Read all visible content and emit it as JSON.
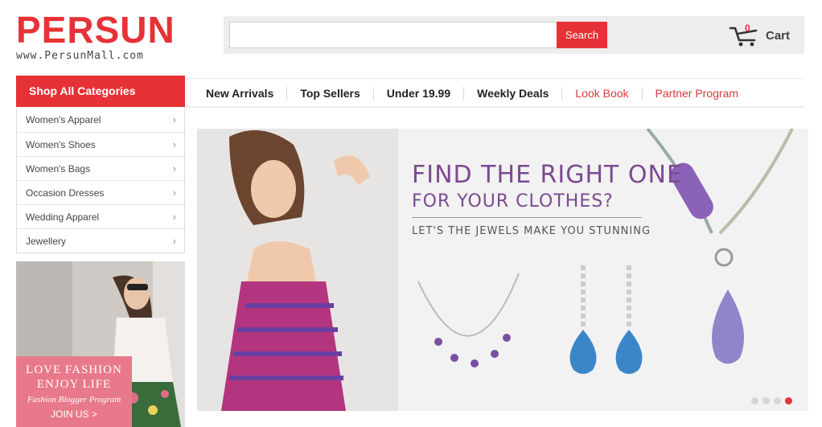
{
  "header": {
    "logo_text": "PERSUN",
    "logo_url": "www.PersunMall.com",
    "search": {
      "placeholder": "",
      "button_label": "Search"
    },
    "cart": {
      "count": "0",
      "label": "Cart"
    }
  },
  "nav": {
    "shop_all": "Shop All Categories",
    "links": [
      {
        "label": "New Arrivals",
        "style": "bold"
      },
      {
        "label": "Top Sellers",
        "style": "bold"
      },
      {
        "label": "Under 19.99",
        "style": "bold"
      },
      {
        "label": "Weekly Deals",
        "style": "bold"
      },
      {
        "label": "Look Book",
        "style": "red"
      },
      {
        "label": "Partner Program",
        "style": "red"
      }
    ]
  },
  "sidebar": {
    "categories": [
      {
        "label": "Women's Apparel"
      },
      {
        "label": "Women's Shoes"
      },
      {
        "label": "Women's Bags"
      },
      {
        "label": "Occasion Dresses"
      },
      {
        "label": "Wedding Apparel"
      },
      {
        "label": "Jewellery"
      }
    ],
    "promo": {
      "line1": "LOVE FASHION",
      "line2": "ENJOY LIFE",
      "line3": "Fashion Blogger Program",
      "line4": "JOIN US >"
    }
  },
  "banner": {
    "heading1": "FIND THE RIGHT ONE",
    "heading2": "FOR YOUR CLOTHES?",
    "subheading": "LET'S THE JEWELS MAKE YOU STUNNING",
    "slides_total": 4,
    "active_slide": 4
  },
  "colors": {
    "brand_red": "#e63236",
    "banner_purple": "#7b4a92",
    "promo_pink": "#e8798a"
  }
}
